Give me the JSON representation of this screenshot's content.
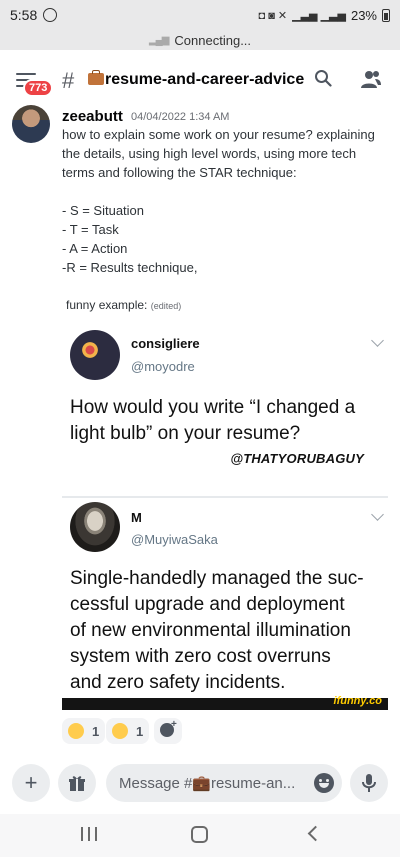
{
  "status_bar": {
    "time": "5:58",
    "battery": "23%"
  },
  "connection": {
    "text": "Connecting..."
  },
  "header": {
    "unread_badge": "773",
    "channel_name": "resume-and-career-advice"
  },
  "message": {
    "author": "zeeabutt",
    "timestamp": "04/04/2022 1:34 AM",
    "lines": [
      "how to explain some work on your resume? explaining",
      "the details, using high level words, using more tech",
      "terms and following the STAR technique:",
      "- S = Situation",
      "- T = Task",
      "- A = Action",
      "-R =  Results technique,"
    ],
    "funny_label": "funny example:",
    "edited": "(edited)"
  },
  "embed": {
    "tweet1": {
      "name": "consigliere",
      "handle": "@moyodre",
      "text_lines": [
        "How would you write “I changed a",
        "light bulb” on your resume?"
      ],
      "credit": "@THATYORUBAGUY"
    },
    "tweet2": {
      "name": "M",
      "handle": "@MuyiwaSaka",
      "text_lines": [
        "Single-handedly managed the suc-",
        "cessful upgrade and deployment",
        "of new environmental illumination",
        "system with zero cost overruns",
        "and zero safety incidents."
      ]
    },
    "watermark": "ifunny.co"
  },
  "reactions": [
    {
      "emoji": "raised-hands",
      "count": "1"
    },
    {
      "emoji": "thumbs-up",
      "count": "1"
    }
  ],
  "composer": {
    "placeholder": "Message #💼resume-an..."
  }
}
